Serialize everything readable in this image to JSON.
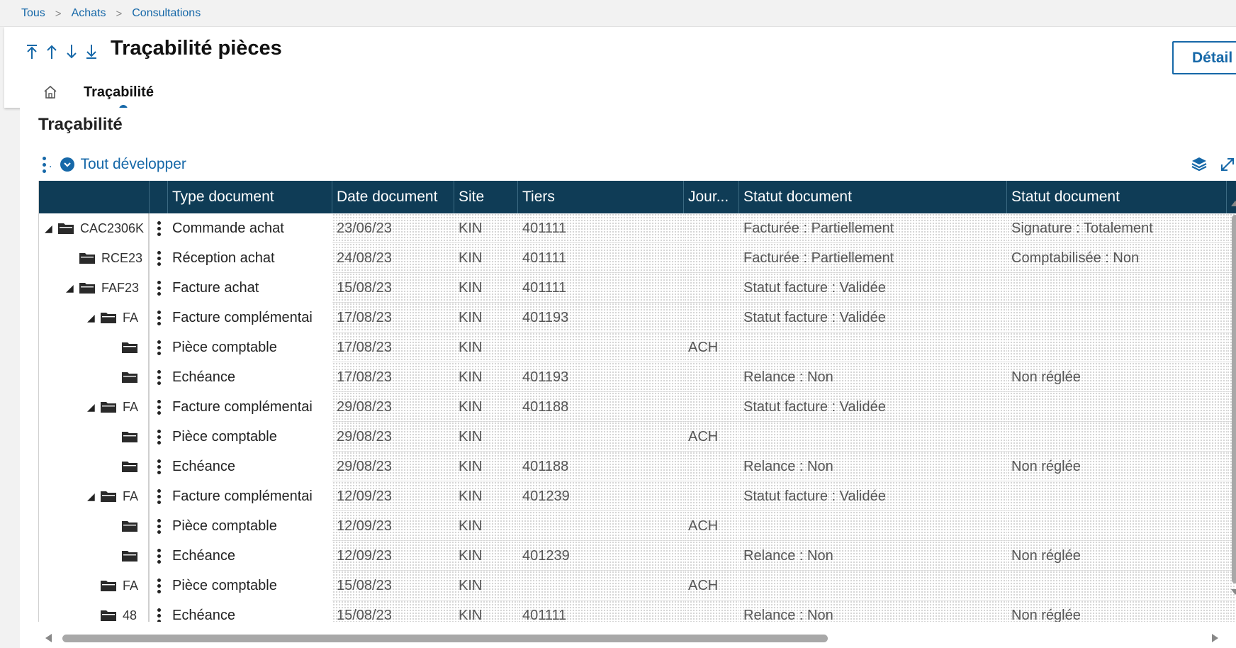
{
  "breadcrumb": [
    "Tous",
    "Achats",
    "Consultations"
  ],
  "header": {
    "title": "Traçabilité pièces",
    "detail_button": "Détail",
    "tab_label": "Traçabilité"
  },
  "section": {
    "title": "Traçabilité",
    "expand_label": "Tout développer"
  },
  "grid": {
    "columns": [
      "Type document",
      "Date document",
      "Site",
      "Tiers",
      "Jour...",
      "Statut document",
      "Statut document"
    ],
    "rows": [
      {
        "code": "CAC2306K",
        "level": 0,
        "toggle": "◢",
        "type": "Commande achat",
        "date": "23/06/23",
        "site": "KIN",
        "tiers": "401111",
        "journal": "",
        "statut1": "Facturée : Partiellement",
        "statut2": "Signature : Totalement"
      },
      {
        "code": "RCE23",
        "level": 1,
        "toggle": "",
        "type": "Réception achat",
        "date": "24/08/23",
        "site": "KIN",
        "tiers": "401111",
        "journal": "",
        "statut1": "Facturée : Partiellement",
        "statut2": "Comptabilisée : Non"
      },
      {
        "code": "FAF23",
        "level": 1,
        "toggle": "◢",
        "type": "Facture achat",
        "date": "15/08/23",
        "site": "KIN",
        "tiers": "401111",
        "journal": "",
        "statut1": "Statut facture : Validée",
        "statut2": ""
      },
      {
        "code": "FA",
        "level": 2,
        "toggle": "◢",
        "type": "Facture complémentai",
        "date": "17/08/23",
        "site": "KIN",
        "tiers": "401193",
        "journal": "",
        "statut1": "Statut facture : Validée",
        "statut2": ""
      },
      {
        "code": "",
        "level": 3,
        "toggle": "",
        "type": "Pièce comptable",
        "date": "17/08/23",
        "site": "KIN",
        "tiers": "",
        "journal": "ACH",
        "statut1": "",
        "statut2": ""
      },
      {
        "code": "",
        "level": 3,
        "toggle": "",
        "type": "Echéance",
        "date": "17/08/23",
        "site": "KIN",
        "tiers": "401193",
        "journal": "",
        "statut1": "Relance : Non",
        "statut2": "Non réglée"
      },
      {
        "code": "FA",
        "level": 2,
        "toggle": "◢",
        "type": "Facture complémentai",
        "date": "29/08/23",
        "site": "KIN",
        "tiers": "401188",
        "journal": "",
        "statut1": "Statut facture : Validée",
        "statut2": ""
      },
      {
        "code": "",
        "level": 3,
        "toggle": "",
        "type": "Pièce comptable",
        "date": "29/08/23",
        "site": "KIN",
        "tiers": "",
        "journal": "ACH",
        "statut1": "",
        "statut2": ""
      },
      {
        "code": "",
        "level": 3,
        "toggle": "",
        "type": "Echéance",
        "date": "29/08/23",
        "site": "KIN",
        "tiers": "401188",
        "journal": "",
        "statut1": "Relance : Non",
        "statut2": "Non réglée"
      },
      {
        "code": "FA",
        "level": 2,
        "toggle": "◢",
        "type": "Facture complémentai",
        "date": "12/09/23",
        "site": "KIN",
        "tiers": "401239",
        "journal": "",
        "statut1": "Statut facture : Validée",
        "statut2": ""
      },
      {
        "code": "",
        "level": 3,
        "toggle": "",
        "type": "Pièce comptable",
        "date": "12/09/23",
        "site": "KIN",
        "tiers": "",
        "journal": "ACH",
        "statut1": "",
        "statut2": ""
      },
      {
        "code": "",
        "level": 3,
        "toggle": "",
        "type": "Echéance",
        "date": "12/09/23",
        "site": "KIN",
        "tiers": "401239",
        "journal": "",
        "statut1": "Relance : Non",
        "statut2": "Non réglée"
      },
      {
        "code": "FA",
        "level": 2,
        "toggle": "",
        "type": "Pièce comptable",
        "date": "15/08/23",
        "site": "KIN",
        "tiers": "",
        "journal": "ACH",
        "statut1": "",
        "statut2": ""
      },
      {
        "code": "48",
        "level": 2,
        "toggle": "",
        "type": "Echéance",
        "date": "15/08/23",
        "site": "KIN",
        "tiers": "401111",
        "journal": "",
        "statut1": "Relance : Non",
        "statut2": "Non réglée"
      }
    ]
  },
  "colors": {
    "accent": "#1668a8",
    "grid_header": "#0f3c56"
  }
}
